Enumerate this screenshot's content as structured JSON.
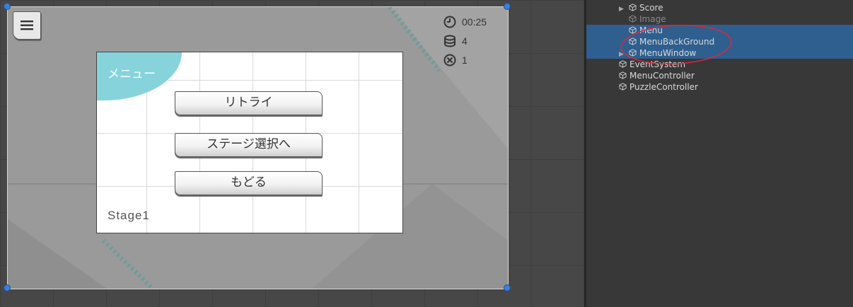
{
  "game": {
    "timer": "00:25",
    "stack_count": "4",
    "miss_count": "1",
    "menu_title": "メニュー",
    "buttons": {
      "retry": "リトライ",
      "stage_select": "ステージ選択へ",
      "back": "もどる"
    },
    "stage_label": "Stage1",
    "colors": {
      "accent": "#86d3dc"
    },
    "icons": {
      "menu": "hamburger-icon",
      "timer": "clock-icon",
      "stack": "database-icon",
      "miss": "x-circle-icon"
    }
  },
  "hierarchy": {
    "items": [
      {
        "label": "Score",
        "indent": 1,
        "expandable": true,
        "dimmed": false,
        "selected": false
      },
      {
        "label": "Image",
        "indent": 1,
        "expandable": false,
        "dimmed": true,
        "selected": false
      },
      {
        "label": "Menu",
        "indent": 1,
        "expandable": false,
        "dimmed": false,
        "selected": true
      },
      {
        "label": "MenuBackGround",
        "indent": 1,
        "expandable": false,
        "dimmed": false,
        "selected": true
      },
      {
        "label": "MenuWindow",
        "indent": 1,
        "expandable": true,
        "dimmed": false,
        "selected": true
      },
      {
        "label": "EventSystem",
        "indent": 0,
        "expandable": false,
        "dimmed": false,
        "selected": false
      },
      {
        "label": "MenuController",
        "indent": 0,
        "expandable": false,
        "dimmed": false,
        "selected": false
      },
      {
        "label": "PuzzleController",
        "indent": 0,
        "expandable": false,
        "dimmed": false,
        "selected": false
      }
    ]
  }
}
